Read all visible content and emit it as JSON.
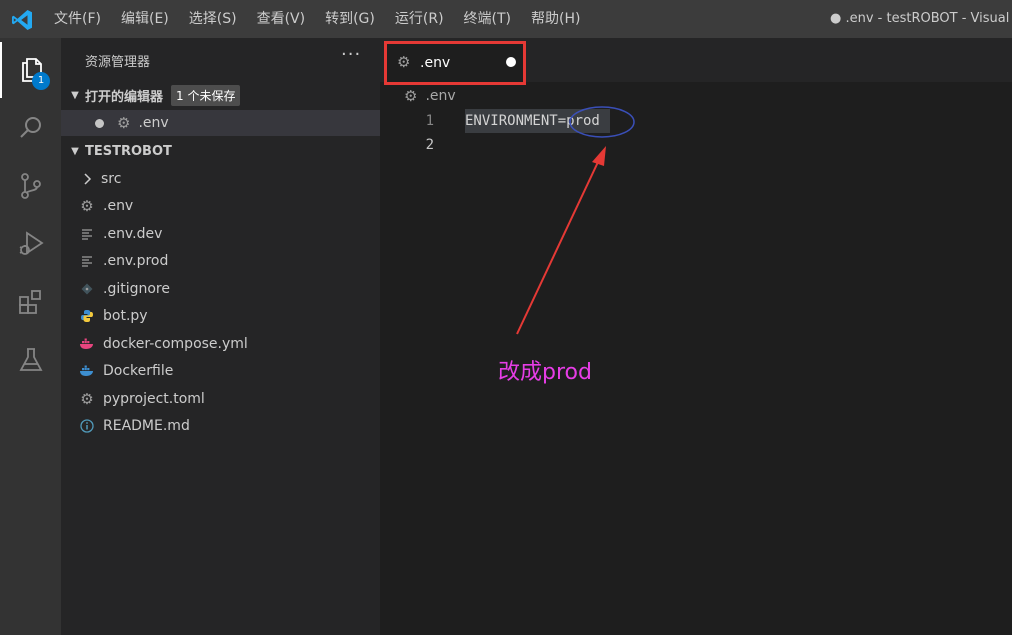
{
  "titlebar": {
    "menu": [
      "文件(F)",
      "编辑(E)",
      "选择(S)",
      "查看(V)",
      "转到(G)",
      "运行(R)",
      "终端(T)",
      "帮助(H)"
    ],
    "window_title": "● .env - testROBOT - Visual S"
  },
  "activitybar": {
    "items": [
      "files-icon",
      "search-icon",
      "source-control-icon",
      "run-debug-icon",
      "extensions-icon",
      "testing-icon"
    ],
    "explorer_badge": "1",
    "accent": "#007acc"
  },
  "sidebar": {
    "title": "资源管理器",
    "more": "···",
    "open_editors_label": "打开的编辑器",
    "unsaved_badge": "1 个未保存",
    "open_editor_file": ".env",
    "project_label": "TESTROBOT",
    "files": [
      {
        "name": "src",
        "icon": "chevron-right-icon"
      },
      {
        "name": ".env",
        "icon": "gear-icon"
      },
      {
        "name": ".env.dev",
        "icon": "lines-icon"
      },
      {
        "name": ".env.prod",
        "icon": "lines-icon"
      },
      {
        "name": ".gitignore",
        "icon": "git-icon"
      },
      {
        "name": "bot.py",
        "icon": "python-icon"
      },
      {
        "name": "docker-compose.yml",
        "icon": "docker-icon"
      },
      {
        "name": "Dockerfile",
        "icon": "docker-icon"
      },
      {
        "name": "pyproject.toml",
        "icon": "gear-icon"
      },
      {
        "name": "README.md",
        "icon": "info-icon"
      }
    ]
  },
  "editor": {
    "tab_label": ".env",
    "breadcrumb": ".env",
    "lines": [
      {
        "number": "1",
        "text": "ENVIRONMENT=prod"
      },
      {
        "number": "2",
        "text": ""
      }
    ]
  },
  "annotation": {
    "text": "改成prod",
    "arrow_color": "#e53935",
    "text_color": "#e63de6"
  }
}
